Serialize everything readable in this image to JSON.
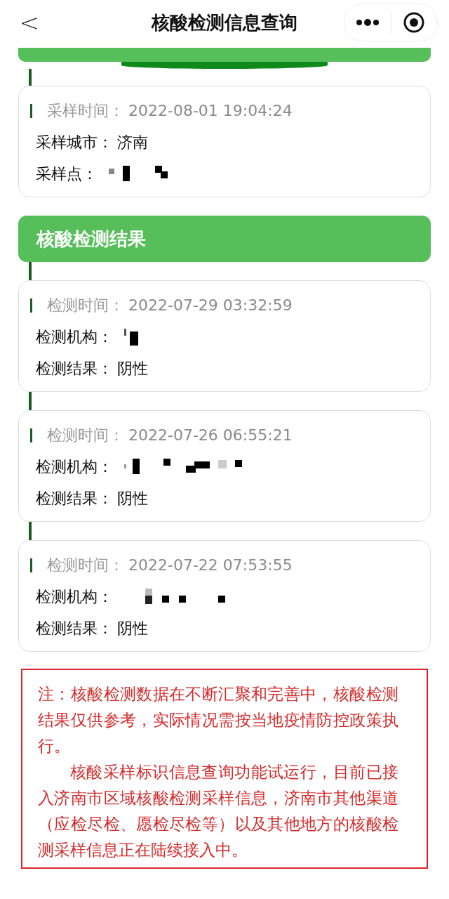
{
  "nav": {
    "title": "核酸检测信息查询",
    "back": "<"
  },
  "sampling": {
    "rows": [
      {
        "kind": "time",
        "label": "采样时间：",
        "value": "2022-08-01 19:04:24"
      },
      {
        "kind": "field",
        "label": "采样城市：",
        "value": "济南"
      },
      {
        "kind": "field",
        "label": "采样点：",
        "redacted": true
      }
    ]
  },
  "results": {
    "title": "核酸检测结果",
    "cards": [
      {
        "rows": [
          {
            "kind": "time",
            "label": "检测时间：",
            "value": "2022-07-29 03:32:59"
          },
          {
            "kind": "field",
            "label": "检测机构：",
            "redacted": true
          },
          {
            "kind": "field",
            "label": "检测结果：",
            "value": "阴性"
          }
        ]
      },
      {
        "rows": [
          {
            "kind": "time",
            "label": "检测时间：",
            "value": "2022-07-26 06:55:21"
          },
          {
            "kind": "field",
            "label": "检测机构：",
            "redacted": true
          },
          {
            "kind": "field",
            "label": "检测结果：",
            "value": "阴性"
          }
        ]
      },
      {
        "rows": [
          {
            "kind": "time",
            "label": "检测时间：",
            "value": "2022-07-22 07:53:55"
          },
          {
            "kind": "field",
            "label": "检测机构：",
            "redacted": true
          },
          {
            "kind": "field",
            "label": "检测结果：",
            "value": "阴性"
          }
        ]
      }
    ]
  },
  "notice": [
    "注：核酸检测数据在不断汇聚和完善中，核酸检测结果仅供参考，实际情况需按当地疫情防控政策执行。",
    "核酸采样标识信息查询功能试运行，目前已接入济南市区域核酸检测采样信息，济南市其他渠道（应检尽检、愿检尽检等）以及其他地方的核酸检测采样信息正在陆续接入中。"
  ]
}
